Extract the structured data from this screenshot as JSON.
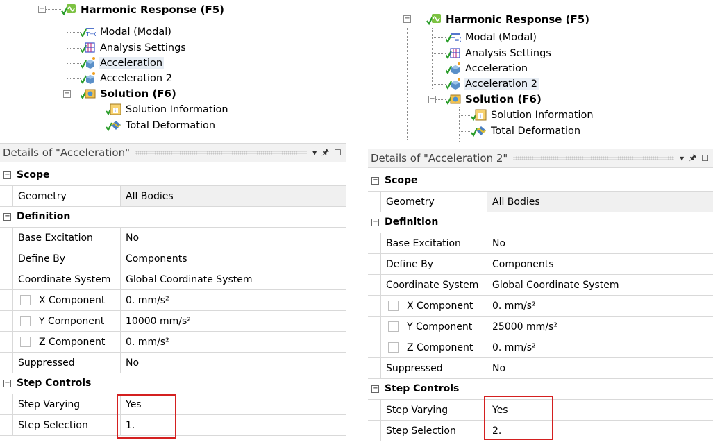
{
  "left": {
    "tree": {
      "root": "Harmonic Response (F5)",
      "items": [
        "Modal (Modal)",
        "Analysis Settings",
        "Acceleration",
        "Acceleration 2"
      ],
      "solution": "Solution (F6)",
      "solution_items": [
        "Solution Information",
        "Total Deformation"
      ],
      "modal_icon_text": "T=0"
    },
    "details": {
      "title": "Details of \"Acceleration\"",
      "scope_label": "Scope",
      "geometry_label": "Geometry",
      "geometry_value": "All Bodies",
      "definition_label": "Definition",
      "base_excitation_label": "Base Excitation",
      "base_excitation_value": "No",
      "define_by_label": "Define By",
      "define_by_value": "Components",
      "coord_label": "Coordinate System",
      "coord_value": "Global Coordinate System",
      "x_label": "X Component",
      "x_value": "0. mm/s²",
      "y_label": "Y Component",
      "y_value": "10000 mm/s²",
      "z_label": "Z Component",
      "z_value": "0. mm/s²",
      "suppressed_label": "Suppressed",
      "suppressed_value": "No",
      "step_controls_label": "Step Controls",
      "step_varying_label": "Step Varying",
      "step_varying_value": "Yes",
      "step_selection_label": "Step Selection",
      "step_selection_value": "1."
    }
  },
  "right": {
    "tree": {
      "root": "Harmonic Response (F5)",
      "items": [
        "Modal (Modal)",
        "Analysis Settings",
        "Acceleration",
        "Acceleration 2"
      ],
      "solution": "Solution (F6)",
      "solution_items": [
        "Solution Information",
        "Total Deformation"
      ],
      "modal_icon_text": "T=0"
    },
    "details": {
      "title": "Details of \"Acceleration 2\"",
      "scope_label": "Scope",
      "geometry_label": "Geometry",
      "geometry_value": "All Bodies",
      "definition_label": "Definition",
      "base_excitation_label": "Base Excitation",
      "base_excitation_value": "No",
      "define_by_label": "Define By",
      "define_by_value": "Components",
      "coord_label": "Coordinate System",
      "coord_value": "Global Coordinate System",
      "x_label": "X Component",
      "x_value": "0. mm/s²",
      "y_label": "Y Component",
      "y_value": "25000 mm/s²",
      "z_label": "Z Component",
      "z_value": "0. mm/s²",
      "suppressed_label": "Suppressed",
      "suppressed_value": "No",
      "step_controls_label": "Step Controls",
      "step_varying_label": "Step Varying",
      "step_varying_value": "Yes",
      "step_selection_label": "Step Selection",
      "step_selection_value": "2."
    }
  },
  "icons": {
    "expander_symbol": "⊟",
    "pin": "🖈",
    "dropdown": "▾",
    "maximize": "☐"
  },
  "colors": {
    "highlight_box": "#d42020",
    "check_green": "#2a9d2a",
    "selection_bg": "#e8eef5"
  }
}
